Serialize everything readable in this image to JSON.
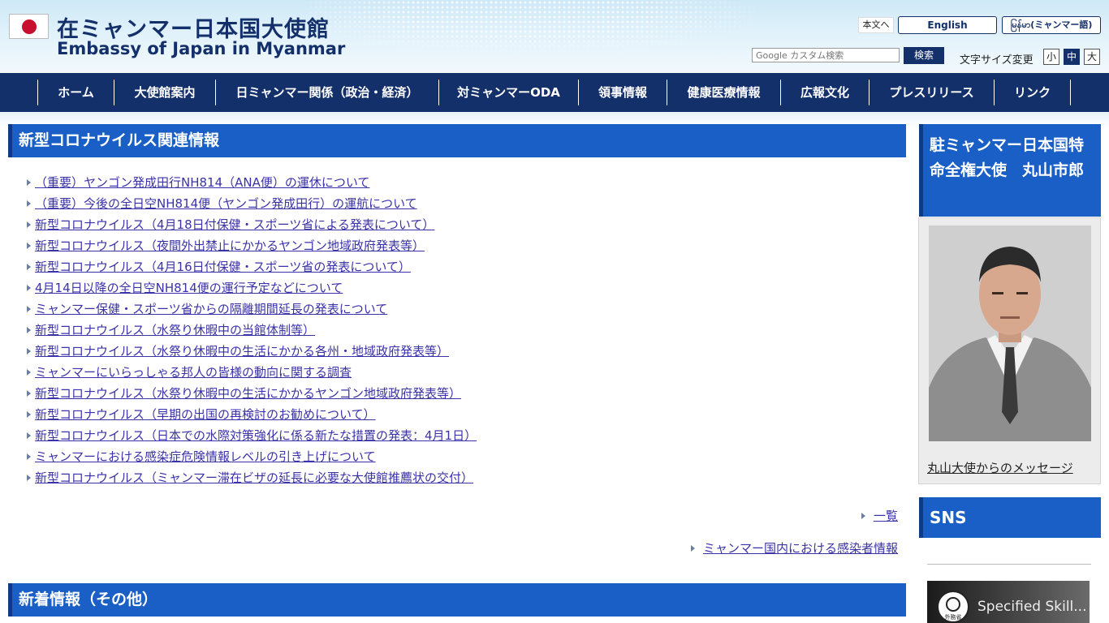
{
  "header": {
    "title_ja": "在ミャンマー日本国大使館",
    "title_en": "Embassy of Japan in Myanmar",
    "skip_label": "本文へ",
    "english_label": "English",
    "myanmar_label": "မြန်မာ(ミャンマー語)",
    "search_placeholder": "Google カスタム検索",
    "search_button": "検索",
    "fontsize_label": "文字サイズ変更",
    "fontsize_small": "小",
    "fontsize_medium": "中",
    "fontsize_large": "大",
    "fontsize_active": "中"
  },
  "nav": [
    {
      "label": "ホーム"
    },
    {
      "label": "大使館案内"
    },
    {
      "label": "日ミャンマー関係（政治・経済）"
    },
    {
      "label": "対ミャンマーODA"
    },
    {
      "label": "領事情報"
    },
    {
      "label": "健康医療情報"
    },
    {
      "label": "広報文化"
    },
    {
      "label": "プレスリリース"
    },
    {
      "label": "リンク"
    }
  ],
  "main": {
    "covid_heading": "新型コロナウイルス関連情報",
    "covid_items": [
      "（重要）ヤンゴン発成田行NH814（ANA便）の運休について",
      "（重要）今後の全日空NH814便（ヤンゴン発成田行）の運航について",
      "新型コロナウイルス（4月18日付保健・スポーツ省による発表について）",
      "新型コロナウイルス（夜間外出禁止にかかるヤンゴン地域政府発表等）",
      "新型コロナウイルス（4月16日付保健・スポーツ省の発表について）",
      "4月14日以降の全日空NH814便の運行予定などについて",
      "ミャンマー保健・スポーツ省からの隔離期間延長の発表について",
      "新型コロナウイルス（水祭り休暇中の当館体制等）",
      "新型コロナウイルス（水祭り休暇中の生活にかかる各州・地域政府発表等）",
      "ミャンマーにいらっしゃる邦人の皆様の動向に関する調査",
      "新型コロナウイルス（水祭り休暇中の生活にかかるヤンゴン地域政府発表等）",
      "新型コロナウイルス（早期の出国の再検討のお勧めについて）",
      "新型コロナウイルス（日本での水際対策強化に係る新たな措置の発表：4月1日）",
      "ミャンマーにおける感染症危険情報レベルの引き上げについて",
      "新型コロナウイルス（ミャンマー滞在ビザの延長に必要な大使館推薦状の交付）"
    ],
    "list_link": "一覧",
    "infection_link": "ミャンマー国内における感染者情報",
    "news_heading": "新着情報（その他）"
  },
  "sidebar": {
    "ambassador_heading": "駐ミャンマー日本国特命全権大使　丸山市郎",
    "ambassador_link": "丸山大使からのメッセージ",
    "sns_heading": "SNS",
    "video_title": "Specified Skill...",
    "video_logo_label": "外務省"
  },
  "colors": {
    "nav_bg": "#14306b",
    "heading_bg": "#1a5fc5",
    "link": "#3a32a8"
  }
}
